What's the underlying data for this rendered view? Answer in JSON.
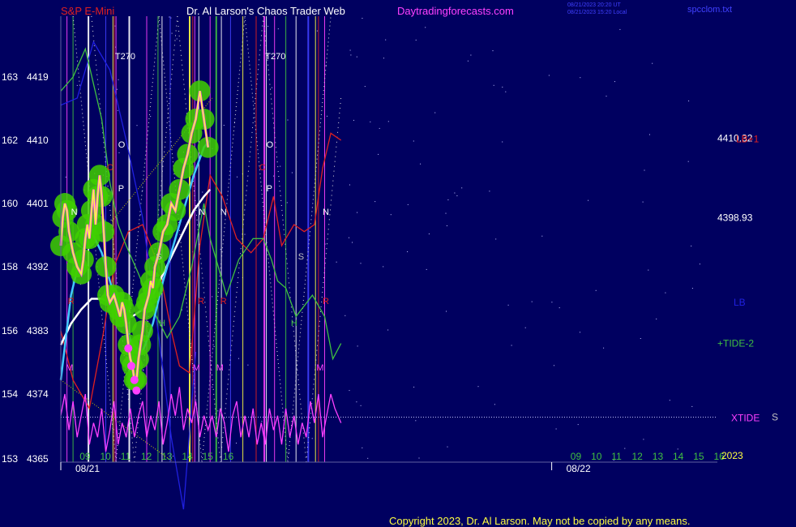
{
  "header": {
    "symbol": "S&P E-Mini",
    "title": "Dr. Al Larson's Chaos Trader Web",
    "site": "Daytradingforecasts.com",
    "stamp1": "08/21/2023 20:20 UT",
    "stamp2": "08/21/2023 15:20 Local",
    "file": "spcclom.txt"
  },
  "copyright": "Copyright 2023, Dr. Al Larson. May not be copied by any means.",
  "colors": {
    "background": "#000060",
    "price_line": "#ffff40",
    "price_glow": "#40d000",
    "overlay_magenta": "#ff40ff",
    "ma_cyan": "#40c8ff",
    "ma_white": "#ffffff",
    "tide_green": "#40c040",
    "lb_red": "#e02020",
    "xtide": "#ff40ff",
    "blue_line": "#2020e0",
    "fib_yellow": "#d0d000"
  },
  "chart_data": {
    "type": "line",
    "title": "S&P E-Mini",
    "ylim": [
      4365,
      4428
    ],
    "y_ticks": [
      {
        "tick": "163",
        "price": "4419",
        "value": 4419
      },
      {
        "tick": "162",
        "price": "4410",
        "value": 4410
      },
      {
        "tick": "160",
        "price": "4401",
        "value": 4401
      },
      {
        "tick": "158",
        "price": "4392",
        "value": 4392
      },
      {
        "tick": "156",
        "price": "4383",
        "value": 4383
      },
      {
        "tick": "154",
        "price": "4374",
        "value": 4374
      },
      {
        "tick": "153",
        "price": "4365",
        "value": 4365
      }
    ],
    "x_hour_labels": [
      {
        "label": "09",
        "hour": 9
      },
      {
        "label": "10",
        "hour": 10
      },
      {
        "label": "11",
        "hour": 11
      },
      {
        "label": "12",
        "hour": 12
      },
      {
        "label": "13",
        "hour": 13
      },
      {
        "label": "14",
        "hour": 14
      },
      {
        "label": "15",
        "hour": 15
      },
      {
        "label": "16",
        "hour": 16
      },
      {
        "label": "09",
        "hour": 33
      },
      {
        "label": "10",
        "hour": 34
      },
      {
        "label": "11",
        "hour": 35
      },
      {
        "label": "12",
        "hour": 36
      },
      {
        "label": "13",
        "hour": 37
      },
      {
        "label": "14",
        "hour": 38
      },
      {
        "label": "15",
        "hour": 39
      },
      {
        "label": "16",
        "hour": 40
      }
    ],
    "x_range_hours": [
      8.0,
      40.1
    ],
    "date_labels": [
      {
        "label": "08/21",
        "hour": 8.0
      },
      {
        "label": "08/22",
        "hour": 32.0
      }
    ],
    "year_label": "2023",
    "right_labels": [
      {
        "text": "4410.32",
        "value": 4410.3,
        "color": "#ffffff"
      },
      {
        "text": "4398.93",
        "value": 4399.0,
        "color": "#ffffff"
      },
      {
        "text": "LB+1",
        "value": 4410.2,
        "color": "#e02020"
      },
      {
        "text": "LB",
        "value": 4387.0,
        "color": "#2020e0"
      },
      {
        "text": "+TIDE-2",
        "value": 4381.2,
        "color": "#40c040"
      },
      {
        "text": "XTIDE",
        "value": 4370.7,
        "color": "#ff40ff"
      },
      {
        "text": "S",
        "value": 4370.8,
        "color": "#c0c0c0"
      }
    ],
    "series": [
      {
        "name": "S&P E-Mini",
        "color": "#ffff40",
        "points": [
          [
            8.0,
            4395
          ],
          [
            8.1,
            4399
          ],
          [
            8.2,
            4401
          ],
          [
            8.3,
            4400
          ],
          [
            8.4,
            4397
          ],
          [
            8.6,
            4394
          ],
          [
            8.8,
            4392
          ],
          [
            9.0,
            4391
          ],
          [
            9.1,
            4393
          ],
          [
            9.2,
            4396
          ],
          [
            9.3,
            4398
          ],
          [
            9.4,
            4396
          ],
          [
            9.5,
            4400
          ],
          [
            9.6,
            4403
          ],
          [
            9.7,
            4398
          ],
          [
            9.8,
            4402
          ],
          [
            9.9,
            4405
          ],
          [
            10.0,
            4402
          ],
          [
            10.1,
            4397
          ],
          [
            10.2,
            4392
          ],
          [
            10.3,
            4388
          ],
          [
            10.4,
            4387
          ],
          [
            10.6,
            4388
          ],
          [
            10.8,
            4386
          ],
          [
            10.9,
            4385
          ],
          [
            11.0,
            4387
          ],
          [
            11.1,
            4386
          ],
          [
            11.2,
            4384
          ],
          [
            11.3,
            4381
          ],
          [
            11.4,
            4379
          ],
          [
            11.5,
            4378
          ],
          [
            11.6,
            4376
          ],
          [
            11.7,
            4376
          ],
          [
            11.8,
            4379
          ],
          [
            11.9,
            4381
          ],
          [
            12.0,
            4383
          ],
          [
            12.1,
            4386
          ],
          [
            12.2,
            4387
          ],
          [
            12.3,
            4388
          ],
          [
            12.4,
            4390
          ],
          [
            12.5,
            4389
          ],
          [
            12.6,
            4392
          ],
          [
            12.8,
            4394
          ],
          [
            13.0,
            4397
          ],
          [
            13.2,
            4398
          ],
          [
            13.4,
            4401
          ],
          [
            13.6,
            4400
          ],
          [
            13.8,
            4403
          ],
          [
            14.0,
            4406
          ],
          [
            14.2,
            4408
          ],
          [
            14.4,
            4411
          ],
          [
            14.6,
            4413
          ],
          [
            14.8,
            4417
          ],
          [
            15.0,
            4413
          ],
          [
            15.2,
            4409
          ]
        ]
      },
      {
        "name": "MA-1",
        "color": "#40c8ff",
        "points": [
          [
            8.0,
            4376
          ],
          [
            8.5,
            4388
          ],
          [
            9.0,
            4394
          ],
          [
            9.5,
            4397
          ],
          [
            10.0,
            4394
          ],
          [
            10.5,
            4389
          ],
          [
            11.0,
            4385
          ],
          [
            11.5,
            4381
          ],
          [
            12.0,
            4380
          ],
          [
            12.5,
            4384
          ],
          [
            13.0,
            4390
          ],
          [
            13.5,
            4395
          ],
          [
            14.0,
            4400
          ],
          [
            14.5,
            4405
          ],
          [
            15.0,
            4409
          ],
          [
            15.3,
            4410
          ]
        ]
      },
      {
        "name": "MA-2",
        "color": "#ffffff",
        "points": [
          [
            8.0,
            4381
          ],
          [
            8.5,
            4384
          ],
          [
            9.0,
            4386
          ],
          [
            9.5,
            4387.5
          ],
          [
            10.0,
            4387.5
          ],
          [
            10.5,
            4387
          ],
          [
            11.0,
            4385
          ],
          [
            11.5,
            4385
          ],
          [
            12.0,
            4386
          ],
          [
            12.5,
            4388
          ],
          [
            13.0,
            4391
          ],
          [
            13.5,
            4394
          ],
          [
            14.0,
            4397
          ],
          [
            14.5,
            4400
          ],
          [
            15.0,
            4402
          ],
          [
            15.3,
            4403
          ]
        ]
      },
      {
        "name": "+TIDE-2",
        "color": "#40c040",
        "points": [
          [
            8.0,
            4417
          ],
          [
            8.6,
            4419
          ],
          [
            9.2,
            4423
          ],
          [
            9.6,
            4418
          ],
          [
            10.0,
            4413
          ],
          [
            10.4,
            4404
          ],
          [
            10.8,
            4398
          ],
          [
            11.2,
            4395
          ],
          [
            11.8,
            4391
          ],
          [
            12.5,
            4386
          ],
          [
            13.2,
            4382
          ],
          [
            13.8,
            4385
          ],
          [
            14.4,
            4392
          ],
          [
            15.0,
            4401
          ],
          [
            15.3,
            4396
          ],
          [
            16.1,
            4388
          ],
          [
            16.7,
            4393
          ],
          [
            17.4,
            4396
          ],
          [
            17.9,
            4396
          ],
          [
            18.3,
            4393
          ],
          [
            18.6,
            4390
          ],
          [
            19.0,
            4389
          ],
          [
            19.5,
            4385
          ],
          [
            20.3,
            4388
          ],
          [
            20.9,
            4385
          ],
          [
            21.3,
            4379
          ],
          [
            21.7,
            4381.2
          ]
        ]
      },
      {
        "name": "LB+1",
        "color": "#e02020",
        "points": [
          [
            8.0,
            4383
          ],
          [
            8.6,
            4376
          ],
          [
            9.4,
            4372
          ],
          [
            10.1,
            4383
          ],
          [
            10.6,
            4392
          ],
          [
            11.3,
            4397
          ],
          [
            12.0,
            4398
          ],
          [
            12.8,
            4392
          ],
          [
            13.4,
            4383
          ],
          [
            13.8,
            4378
          ],
          [
            14.3,
            4377
          ],
          [
            14.8,
            4395
          ],
          [
            15.3,
            4405
          ],
          [
            15.9,
            4402
          ],
          [
            16.6,
            4396
          ],
          [
            17.3,
            4394
          ],
          [
            17.9,
            4396
          ],
          [
            18.4,
            4402
          ],
          [
            18.8,
            4395
          ],
          [
            19.4,
            4398
          ],
          [
            19.9,
            4397
          ],
          [
            20.4,
            4398
          ],
          [
            20.8,
            4406
          ],
          [
            21.2,
            4411
          ],
          [
            21.7,
            4410
          ]
        ]
      },
      {
        "name": "LB",
        "color": "#2020e0",
        "points": [
          [
            8.0,
            4415
          ],
          [
            8.8,
            4416
          ],
          [
            9.6,
            4424
          ],
          [
            10.4,
            4420
          ],
          [
            11.2,
            4410
          ],
          [
            12.0,
            4399
          ],
          [
            12.8,
            4382
          ],
          [
            13.4,
            4368
          ],
          [
            14.0,
            4358
          ],
          [
            14.6,
            4380
          ]
        ]
      },
      {
        "name": "XTIDE",
        "color": "#ff40ff",
        "points": [
          [
            8.0,
            4371
          ],
          [
            8.2,
            4374
          ],
          [
            8.4,
            4369
          ],
          [
            8.6,
            4373
          ],
          [
            8.8,
            4368
          ],
          [
            9.0,
            4371
          ],
          [
            9.2,
            4374
          ],
          [
            9.4,
            4367
          ],
          [
            9.6,
            4370
          ],
          [
            9.8,
            4368
          ],
          [
            10.0,
            4372
          ],
          [
            10.2,
            4366
          ],
          [
            10.4,
            4369
          ],
          [
            10.6,
            4373
          ],
          [
            10.8,
            4367
          ],
          [
            11.0,
            4370
          ],
          [
            11.2,
            4368
          ],
          [
            11.4,
            4372
          ],
          [
            11.6,
            4368
          ],
          [
            11.8,
            4371
          ],
          [
            12.0,
            4373
          ],
          [
            12.2,
            4368
          ],
          [
            12.4,
            4371
          ],
          [
            12.6,
            4369
          ],
          [
            12.8,
            4373
          ],
          [
            13.0,
            4367
          ],
          [
            13.2,
            4370
          ],
          [
            13.4,
            4374
          ],
          [
            13.6,
            4371
          ],
          [
            13.8,
            4375
          ],
          [
            14.0,
            4369
          ],
          [
            14.2,
            4372
          ],
          [
            14.4,
            4370
          ],
          [
            14.6,
            4373
          ],
          [
            14.8,
            4368
          ],
          [
            15.0,
            4371
          ],
          [
            15.2,
            4369
          ],
          [
            15.4,
            4371
          ],
          [
            15.6,
            4368
          ],
          [
            15.8,
            4372
          ],
          [
            16.0,
            4370
          ],
          [
            16.2,
            4366
          ],
          [
            16.4,
            4371
          ],
          [
            16.6,
            4373
          ],
          [
            16.8,
            4368
          ],
          [
            17.0,
            4371
          ],
          [
            17.2,
            4368
          ],
          [
            17.4,
            4372
          ],
          [
            17.6,
            4367
          ],
          [
            17.8,
            4370
          ],
          [
            18.0,
            4367
          ],
          [
            18.2,
            4372
          ],
          [
            18.4,
            4369
          ],
          [
            18.6,
            4371
          ],
          [
            18.8,
            4367
          ],
          [
            19.0,
            4372
          ],
          [
            19.2,
            4368
          ],
          [
            19.4,
            4371
          ],
          [
            19.6,
            4367
          ],
          [
            19.8,
            4370
          ],
          [
            20.0,
            4368
          ],
          [
            20.2,
            4373
          ],
          [
            20.4,
            4370
          ],
          [
            20.6,
            4374
          ],
          [
            20.8,
            4368
          ],
          [
            21.0,
            4371
          ],
          [
            21.2,
            4374
          ],
          [
            21.4,
            4372
          ],
          [
            21.7,
            4370
          ]
        ]
      }
    ],
    "vertical_markers": [
      {
        "label": "N",
        "hour": 8.5,
        "color": "#ffffff"
      },
      {
        "label": "C",
        "hour": 10.25,
        "color": "#e02020"
      },
      {
        "label": "T270",
        "hour": 10.65,
        "color": "#ffffff"
      },
      {
        "label": "O",
        "hour": 10.8,
        "color": "#ffffff"
      },
      {
        "label": "P",
        "hour": 10.8,
        "color": "#ffffff"
      },
      {
        "label": "R",
        "hour": 8.35,
        "color": "#e02020"
      },
      {
        "label": "M",
        "hour": 8.25,
        "color": "#ff40ff"
      },
      {
        "label": "S",
        "hour": 12.65,
        "color": "#c0c0c0"
      },
      {
        "label": "H",
        "hour": 12.8,
        "color": "#40c040"
      },
      {
        "label": "N",
        "hour": 14.75,
        "color": "#ffffff"
      },
      {
        "label": "R",
        "hour": 14.7,
        "color": "#e02020"
      },
      {
        "label": "M",
        "hour": 14.45,
        "color": "#ff40ff"
      },
      {
        "label": "N",
        "hour": 15.8,
        "color": "#ffffff"
      },
      {
        "label": "R",
        "hour": 15.8,
        "color": "#e02020"
      },
      {
        "label": "M",
        "hour": 15.6,
        "color": "#ff40ff"
      },
      {
        "label": "C",
        "hour": 17.7,
        "color": "#e02020"
      },
      {
        "label": "T270",
        "hour": 18.0,
        "color": "#ffffff"
      },
      {
        "label": "O",
        "hour": 18.05,
        "color": "#ffffff"
      },
      {
        "label": "P",
        "hour": 18.05,
        "color": "#ffffff"
      },
      {
        "label": "S",
        "hour": 19.6,
        "color": "#c0c0c0"
      },
      {
        "label": "H",
        "hour": 19.25,
        "color": "#40c040"
      },
      {
        "label": "N",
        "hour": 20.8,
        "color": "#ffffff"
      },
      {
        "label": "R",
        "hour": 20.8,
        "color": "#e02020"
      },
      {
        "label": "M",
        "hour": 20.5,
        "color": "#ff40ff"
      }
    ]
  }
}
